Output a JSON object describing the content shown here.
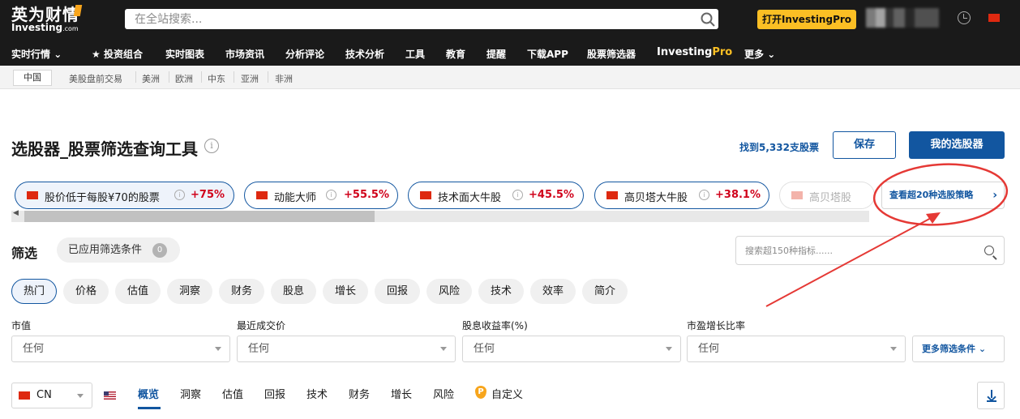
{
  "header": {
    "logo_cn": "英为财情",
    "logo_en": "Investing",
    "logo_domain": ".com",
    "search_placeholder": "在全站搜索...",
    "pro_button": "打开InvestingPro",
    "nav": [
      "实时行情",
      "投资组合",
      "实时图表",
      "市场资讯",
      "分析评论",
      "技术分析",
      "工具",
      "教育",
      "提醒",
      "下载APP",
      "股票筛选器"
    ],
    "nav_pro_a": "Investing",
    "nav_pro_b": "Pro",
    "nav_more": "更多"
  },
  "subnav": {
    "active": "中国",
    "items": [
      "美股盘前交易",
      "美洲",
      "欧洲",
      "中东",
      "亚洲",
      "非洲"
    ]
  },
  "page": {
    "title": "选股器_股票筛选查询工具",
    "found": "找到5,332支股票",
    "save": "保存",
    "my_screener": "我的选股器"
  },
  "strategies": [
    {
      "label": "股价低于每股¥70的股票",
      "pct": "+75%"
    },
    {
      "label": "动能大师",
      "pct": "+55.5%"
    },
    {
      "label": "技术面大牛股",
      "pct": "+45.5%"
    },
    {
      "label": "高贝塔大牛股",
      "pct": "+38.1%"
    },
    {
      "label": "高贝塔股",
      "pct": ""
    }
  ],
  "more_strategies": "查看超20种选股策略",
  "filters": {
    "title": "筛选",
    "applied": "已应用筛选条件",
    "applied_count": "0",
    "search_placeholder": "搜索超150种指标......",
    "categories": [
      "热门",
      "价格",
      "估值",
      "洞察",
      "财务",
      "股息",
      "增长",
      "回报",
      "风险",
      "技术",
      "效率",
      "简介"
    ],
    "fields": [
      {
        "label": "市值",
        "value": "任何"
      },
      {
        "label": "最近成交价",
        "value": "任何"
      },
      {
        "label": "股息收益率(%)",
        "value": "任何"
      },
      {
        "label": "市盈增长比率",
        "value": "任何"
      }
    ],
    "more": "更多筛选条件"
  },
  "results": {
    "country": "CN",
    "tabs": [
      "概览",
      "洞察",
      "估值",
      "回报",
      "技术",
      "财务",
      "增长",
      "风险",
      "自定义"
    ]
  },
  "colors": {
    "brand_blue": "#1256a0",
    "positive_red": "#d0021b",
    "pro_yellow": "#fbbf24",
    "annotation_red": "#e53935"
  }
}
